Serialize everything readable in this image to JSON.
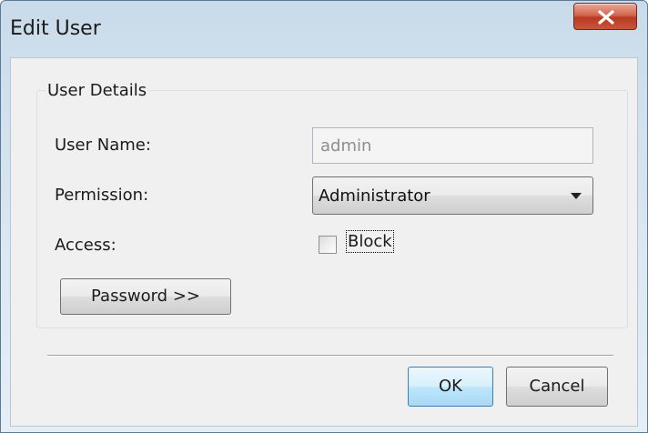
{
  "window": {
    "title": "Edit User"
  },
  "group": {
    "title": "User Details",
    "user_name": {
      "label": "User Name:",
      "value": "admin"
    },
    "permission": {
      "label": "Permission:",
      "selected": "Administrator"
    },
    "access": {
      "label": "Access:",
      "checkbox_label": "Block",
      "checked": false
    },
    "password_button": "Password >>"
  },
  "buttons": {
    "ok": "OK",
    "cancel": "Cancel"
  }
}
